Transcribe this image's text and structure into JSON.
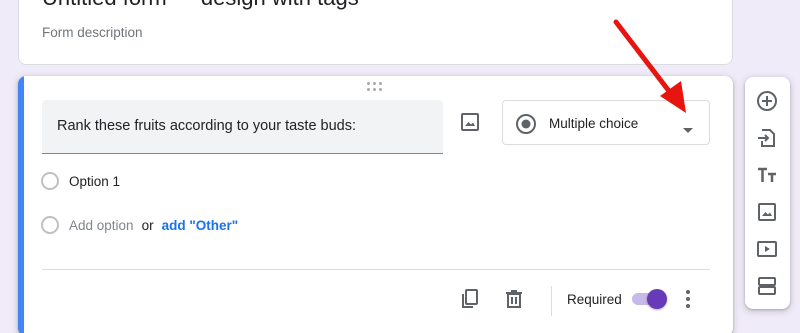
{
  "top_card": {
    "title_partial": "Untitled form — design with tags",
    "description_placeholder": "Form description"
  },
  "question": {
    "title": "Rank these fruits according to your taste buds:",
    "type": "Multiple choice",
    "options": [
      {
        "label": "Option 1"
      }
    ],
    "add_option": "Add option",
    "or": "or",
    "add_other": "add \"Other\"",
    "required_label": "Required",
    "required": true
  },
  "icons": {
    "drag": "drag-handle-icon",
    "image": "image-icon",
    "radio": "radio-button-icon",
    "caret": "dropdown-caret-icon",
    "duplicate": "duplicate-icon",
    "delete": "trash-icon",
    "more": "more-vert-icon"
  },
  "toolbar": {
    "items": [
      {
        "name": "add-question",
        "icon": "add-circle-icon"
      },
      {
        "name": "import-questions",
        "icon": "import-icon"
      },
      {
        "name": "add-title",
        "icon": "title-text-icon"
      },
      {
        "name": "add-image",
        "icon": "image-icon"
      },
      {
        "name": "add-video",
        "icon": "video-icon"
      },
      {
        "name": "add-section",
        "icon": "section-icon"
      }
    ]
  },
  "colors": {
    "background": "#f0ebf8",
    "accent_blue": "#4285f4",
    "theme_purple": "#673ab7",
    "link_blue": "#1a73e8",
    "annotation_red": "#e8140f"
  }
}
